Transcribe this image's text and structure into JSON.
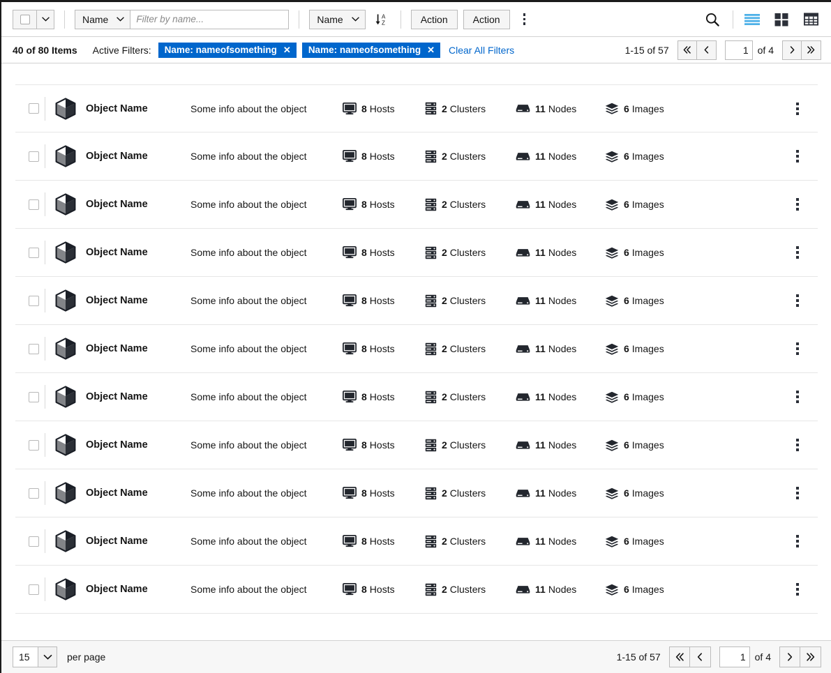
{
  "toolbar": {
    "bulk_select": {
      "name": "bulk-select",
      "checked": false
    },
    "filter_type": {
      "label": "Name"
    },
    "filter_input": {
      "value": "",
      "placeholder": "Filter by name..."
    },
    "sort_field": {
      "label": "Name"
    },
    "sort_direction_icon": "sort-az-descending-icon",
    "actions": [
      {
        "label": "Action"
      },
      {
        "label": "Action"
      }
    ],
    "overflow_icon": "kebab-vertical-icon",
    "search_icon": "search-icon",
    "views": [
      {
        "name": "list-view",
        "icon": "list-view-icon",
        "active": true,
        "color": "#4eb1e8"
      },
      {
        "name": "card-view",
        "icon": "card-view-icon",
        "active": false,
        "color": "#2c3039"
      },
      {
        "name": "table-view",
        "icon": "table-view-icon",
        "active": false,
        "color": "#2c3039"
      }
    ]
  },
  "filter_bar": {
    "items_count": "40 of 80 Items",
    "active_filters_label": "Active Filters:",
    "chips": [
      {
        "label": "Name: nameofsomething",
        "remove_icon": "close-icon"
      },
      {
        "label": "Name: nameofsomething",
        "remove_icon": "close-icon"
      }
    ],
    "clear_all_label": "Clear All Filters",
    "chip_color": "#06c",
    "pagination": {
      "range": "1-15 of 57",
      "first_icon": "angle-double-left-icon",
      "prev_icon": "angle-left-icon",
      "page_value": "1",
      "of_label": "of 4",
      "next_icon": "angle-right-icon",
      "last_icon": "angle-double-right-icon"
    }
  },
  "list": {
    "row_template": {
      "name": "Object Name",
      "description": "Some info about the object",
      "object_icon": "cube-icon",
      "actions_icon": "kebab-vertical-icon",
      "metrics": [
        {
          "key": "hosts",
          "value": "8",
          "label": "Hosts",
          "icon": "monitor-icon"
        },
        {
          "key": "clusters",
          "value": "2",
          "label": "Clusters",
          "icon": "server-rack-icon"
        },
        {
          "key": "nodes",
          "value": "11",
          "label": "Nodes",
          "icon": "server-node-icon"
        },
        {
          "key": "images",
          "value": "6",
          "label": "Images",
          "icon": "layers-icon"
        }
      ]
    },
    "row_count": 11
  },
  "bottom_bar": {
    "per_page_value": "15",
    "per_page_label": "per page",
    "pagination": {
      "range": "1-15 of 57",
      "first_icon": "angle-double-left-icon",
      "prev_icon": "angle-left-icon",
      "page_value": "1",
      "of_label": "of 4",
      "next_icon": "angle-right-icon",
      "last_icon": "angle-double-right-icon"
    }
  }
}
